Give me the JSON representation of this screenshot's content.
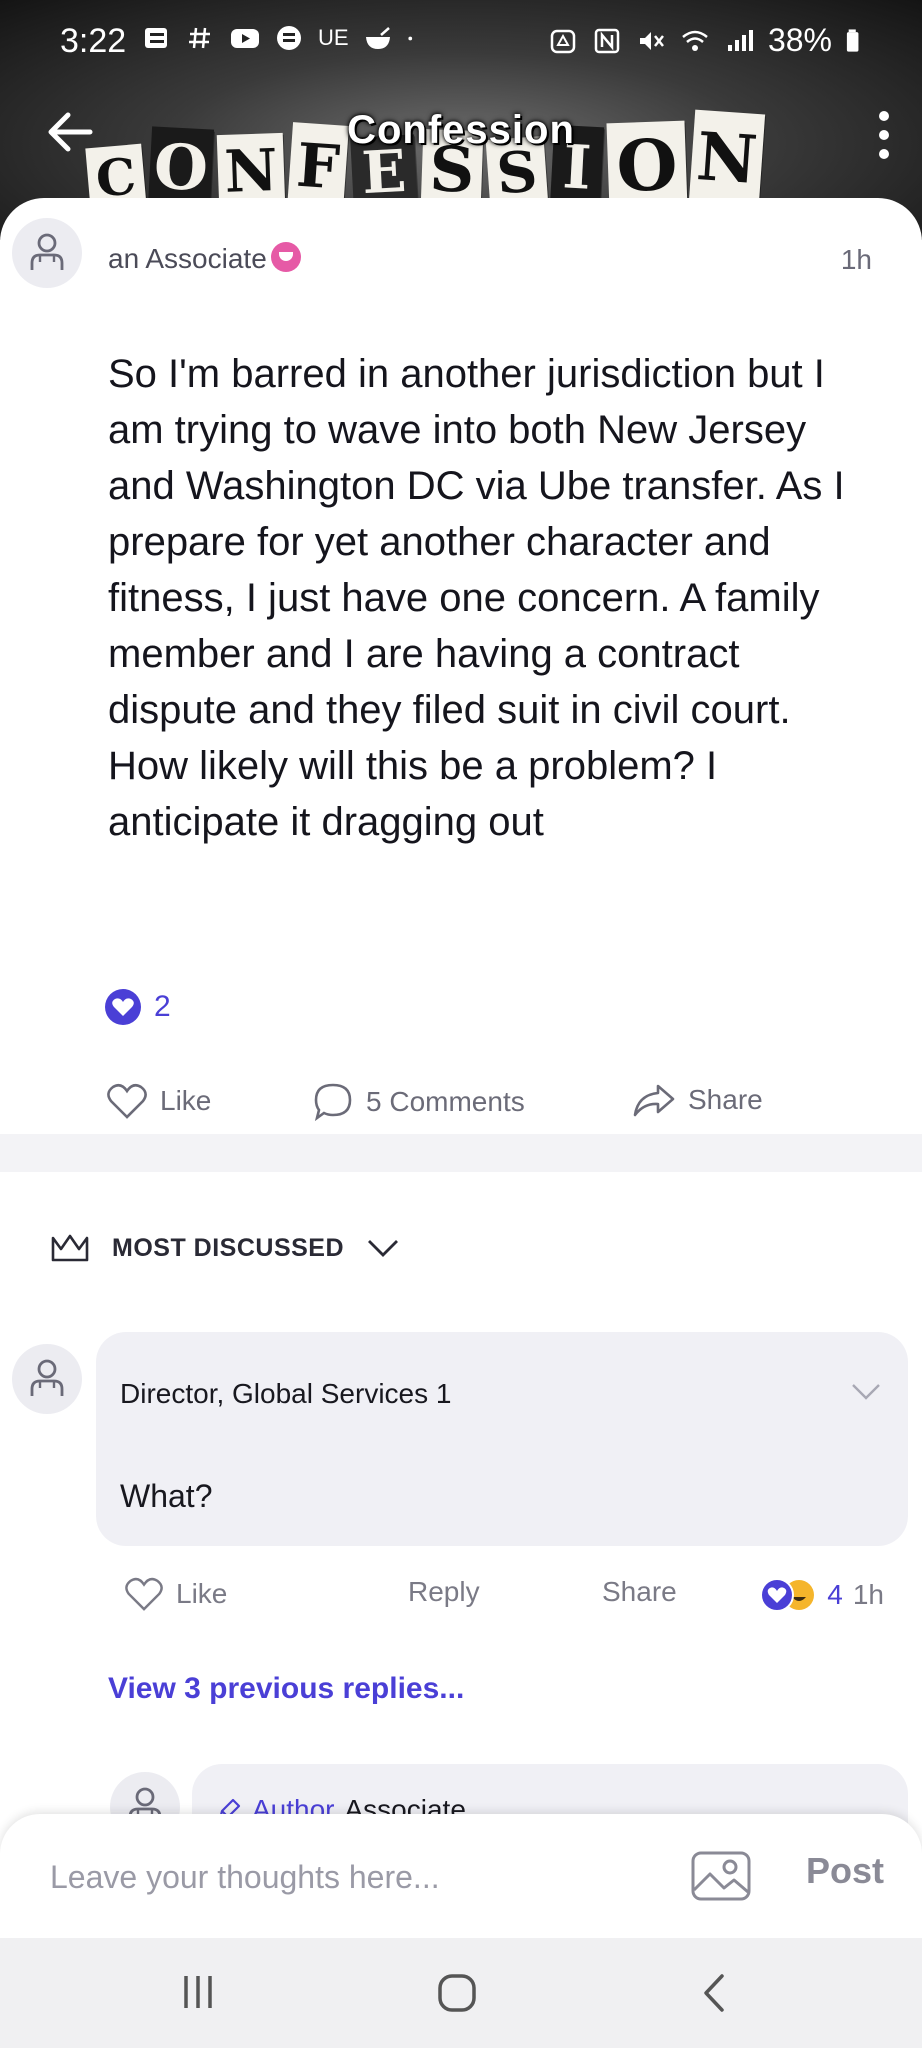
{
  "status_bar": {
    "time": "3:22",
    "left_icons": [
      "notes-icon",
      "hashtag-icon",
      "youtube-icon",
      "message-icon",
      "ue-label",
      "rice-bowl-icon",
      "dot-icon"
    ],
    "ue_label": "UE",
    "right_icons": [
      "recycle-icon",
      "nfc-icon",
      "mute-icon",
      "wifi-icon",
      "signal-icon",
      "battery-icon"
    ],
    "battery": "38%"
  },
  "header": {
    "title": "Confession",
    "collage_letters": [
      "C",
      "O",
      "N",
      "F",
      "E",
      "S",
      "S",
      "I",
      "O",
      "N"
    ],
    "back_icon": "arrow-left-icon",
    "menu_icon": "more-vertical-icon"
  },
  "post": {
    "author": "an Associate",
    "time": "1h",
    "body": "So I'm barred in another jurisdiction but I am trying to wave into both New Jersey and Washington DC via Ube transfer. As I prepare for yet another character and fitness, I just have one concern. A family member and I are having a contract dispute and they filed suit in civil court. How likely will this be a problem? I anticipate it dragging out",
    "reaction_count": "2",
    "actions": {
      "like": "Like",
      "comments": "5 Comments",
      "share": "Share"
    }
  },
  "sort": {
    "label": "MOST DISCUSSED"
  },
  "comment": {
    "author": "Director, Global Services 1",
    "text": "What?",
    "actions": {
      "like": "Like",
      "reply": "Reply",
      "share": "Share"
    },
    "reaction_count": "4",
    "time": "1h"
  },
  "view_replies": "View 3 previous replies...",
  "reply": {
    "author_tag": "Author",
    "author": "Associate"
  },
  "input": {
    "placeholder": "Leave your thoughts here...",
    "post_label": "Post"
  },
  "colors": {
    "accent": "#4a3fd6",
    "badge": "#e65aa6",
    "muted_text": "#6b6b78"
  }
}
